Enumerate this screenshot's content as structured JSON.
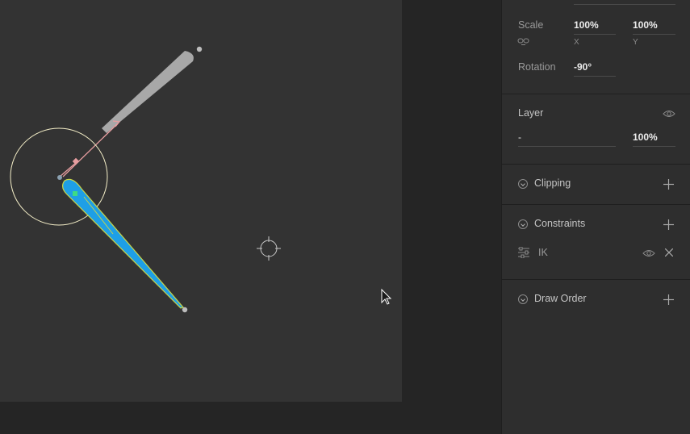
{
  "transform": {
    "scale_label": "Scale",
    "scale_x": "100%",
    "scale_y": "100%",
    "x_label": "X",
    "y_label": "Y",
    "rotation_label": "Rotation",
    "rotation_value": "-90°"
  },
  "layer": {
    "label": "Layer",
    "blend_value": "-",
    "opacity_value": "100%"
  },
  "sections": {
    "clipping": "Clipping",
    "constraints": "Constraints",
    "draw_order": "Draw Order"
  },
  "constraint_item": {
    "label": "IK"
  },
  "colors": {
    "artboard": "#333333",
    "mesh_fill": "#1e9fe6",
    "mesh_outline": "#c8d64a",
    "bone_pink": "#e79ea0",
    "ik_circle": "#f5efc8"
  }
}
